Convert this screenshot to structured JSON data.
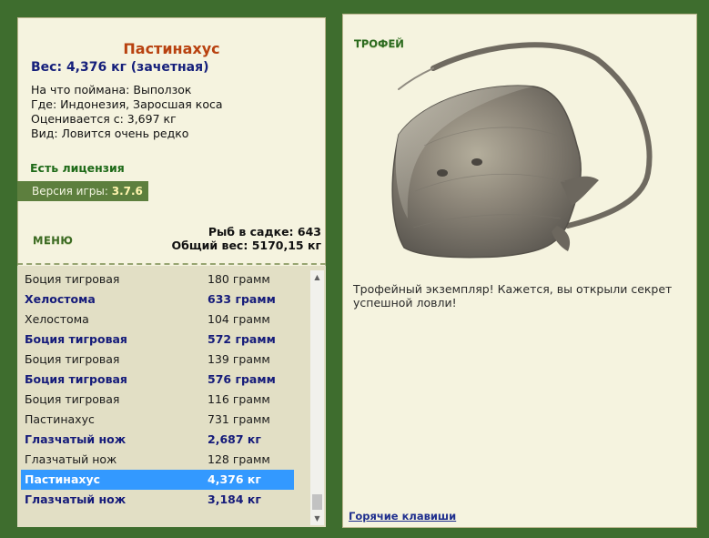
{
  "fish": {
    "name": "Пастинахус",
    "weight_line": "Вес: 4,376 кг (зачетная)",
    "bait": "На что поймана: Выползок",
    "location": "Где: Индонезия, Заросшая коса",
    "valued_from": "Оценивается с: 3,697 кг",
    "species_rarity": "Вид: Ловится очень редко"
  },
  "license": "Есть лицензия",
  "version": {
    "label": "Версия игры:",
    "value": "3.7.6"
  },
  "menu_label": "МЕНЮ",
  "catch_stats": {
    "fish_count": "Рыб в садке: 643",
    "total_weight": "Общий вес: 5170,15 кг"
  },
  "catch_list": [
    {
      "name": "Боция тигровая",
      "weight": "180 грамм",
      "trophy": false,
      "selected": false
    },
    {
      "name": "Хелостома",
      "weight": "633 грамм",
      "trophy": true,
      "selected": false
    },
    {
      "name": "Хелостома",
      "weight": "104 грамм",
      "trophy": false,
      "selected": false
    },
    {
      "name": "Боция тигровая",
      "weight": "572 грамм",
      "trophy": true,
      "selected": false
    },
    {
      "name": "Боция тигровая",
      "weight": "139 грамм",
      "trophy": false,
      "selected": false
    },
    {
      "name": "Боция тигровая",
      "weight": "576 грамм",
      "trophy": true,
      "selected": false
    },
    {
      "name": "Боция тигровая",
      "weight": "116 грамм",
      "trophy": false,
      "selected": false
    },
    {
      "name": "Пастинахус",
      "weight": "731 грамм",
      "trophy": false,
      "selected": false
    },
    {
      "name": "Глазчатый нож",
      "weight": "2,687 кг",
      "trophy": true,
      "selected": false
    },
    {
      "name": "Глазчатый нож",
      "weight": "128 грамм",
      "trophy": false,
      "selected": false
    },
    {
      "name": "Пастинахус",
      "weight": "4,376 кг",
      "trophy": true,
      "selected": true
    },
    {
      "name": "Глазчатый нож",
      "weight": "3,184 кг",
      "trophy": true,
      "selected": false
    }
  ],
  "trophy_label": "ТРОФЕЙ",
  "trophy_message": "Трофейный экземпляр! Кажется, вы открыли секрет успешной ловли!",
  "hotkeys_link": "Горячие клавиши",
  "colors": {
    "background": "#3e6d2e",
    "panel": "#f5f3df",
    "fish_name": "#b8410f",
    "weight": "#151f7b",
    "license": "#1e6a18",
    "version_bg": "#5d7f3e",
    "list_bg": "#e2dfc5",
    "selection": "#3399ff",
    "trophy_row": "#151b7a"
  },
  "icons": {
    "scroll_up": "chevron-up-icon",
    "scroll_down": "chevron-down-icon"
  }
}
